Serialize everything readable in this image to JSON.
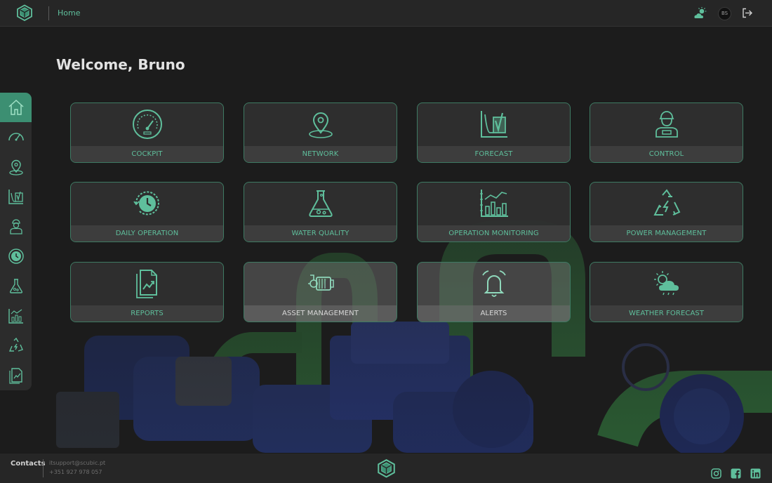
{
  "header": {
    "breadcrumb": "Home",
    "avatar_initials": "BS"
  },
  "main": {
    "welcome": "Welcome, Bruno"
  },
  "sidebar": {
    "items": [
      {
        "name": "home",
        "active": true
      },
      {
        "name": "cockpit"
      },
      {
        "name": "network"
      },
      {
        "name": "forecast"
      },
      {
        "name": "control"
      },
      {
        "name": "daily-operation"
      },
      {
        "name": "water-quality"
      },
      {
        "name": "operation-monitoring"
      },
      {
        "name": "power-management"
      },
      {
        "name": "reports"
      }
    ]
  },
  "cards": [
    {
      "label": "COCKPIT",
      "icon": "speedometer-icon"
    },
    {
      "label": "NETWORK",
      "icon": "map-pin-icon"
    },
    {
      "label": "FORECAST",
      "icon": "chart-check-icon"
    },
    {
      "label": "CONTROL",
      "icon": "operator-icon"
    },
    {
      "label": "DAILY OPERATION",
      "icon": "clock-history-icon"
    },
    {
      "label": "WATER QUALITY",
      "icon": "flask-icon"
    },
    {
      "label": "OPERATION MONITORING",
      "icon": "bar-chart-icon"
    },
    {
      "label": "POWER MANAGEMENT",
      "icon": "recycle-power-icon"
    },
    {
      "label": "REPORTS",
      "icon": "report-icon"
    },
    {
      "label": "ASSET MANAGEMENT",
      "icon": "pump-icon"
    },
    {
      "label": "ALERTS",
      "icon": "bell-alert-icon"
    },
    {
      "label": "WEATHER FORECAST",
      "icon": "weather-icon"
    }
  ],
  "footer": {
    "contacts_label": "Contacts",
    "email": "itsupport@scubic.pt",
    "phone": "+351 927 978 057",
    "social": [
      "instagram-icon",
      "facebook-icon",
      "linkedin-icon"
    ]
  },
  "colors": {
    "accent": "#5fbf9c",
    "active": "#3c8f72",
    "background": "#1b1b1b",
    "bar": "#262626"
  }
}
